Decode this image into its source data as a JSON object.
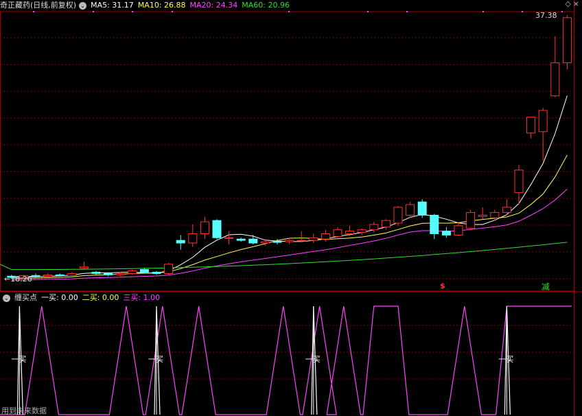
{
  "main_header": {
    "title": "奇正藏药(日线,前复权)",
    "ma": [
      {
        "label": "MA5: 31.17",
        "color": "#ffffff"
      },
      {
        "label": "MA10: 26.88",
        "color": "#ffff55"
      },
      {
        "label": "MA20: 24.34",
        "color": "#ff44ff"
      },
      {
        "label": "MA60: 20.96",
        "color": "#33dd33"
      }
    ]
  },
  "price_labels": {
    "high": "37.38",
    "low": "18.26"
  },
  "markers": {
    "sell": "$",
    "reduce": "减"
  },
  "indicator_header": {
    "name": "缠买点",
    "items": [
      {
        "label": "一买: 0.00",
        "color": "#ffffff"
      },
      {
        "label": "二买: 0.00",
        "color": "#ffff55"
      },
      {
        "label": "三买: 1.00",
        "color": "#ff44ff"
      }
    ]
  },
  "signal_label": "一买",
  "footer_text": "用到未来数据",
  "colors": {
    "up": "#ff3333",
    "down": "#55ffff",
    "grid": "#8b0000",
    "border": "#a00000"
  },
  "chart_data": {
    "type": "candlestick",
    "title": "奇正藏药(日线,前复权)",
    "candles": [
      [
        18.4,
        18.5,
        18.2,
        18.3
      ],
      [
        18.3,
        18.5,
        18.2,
        18.45
      ],
      [
        18.45,
        18.6,
        18.3,
        18.4
      ],
      [
        18.4,
        18.6,
        18.3,
        18.5
      ],
      [
        18.5,
        18.6,
        18.4,
        18.45
      ],
      [
        18.45,
        18.7,
        18.4,
        18.6
      ],
      [
        19.0,
        19.5,
        18.9,
        19.1
      ],
      [
        18.7,
        18.8,
        18.5,
        18.6
      ],
      [
        18.6,
        18.7,
        18.4,
        18.5
      ],
      [
        18.5,
        18.7,
        18.4,
        18.6
      ],
      [
        18.6,
        18.9,
        18.5,
        18.8
      ],
      [
        18.9,
        19.0,
        18.6,
        18.7
      ],
      [
        18.7,
        18.8,
        18.5,
        18.6
      ],
      [
        18.6,
        19.4,
        18.5,
        19.3
      ],
      [
        21.1,
        21.5,
        20.4,
        20.9
      ],
      [
        20.9,
        22.3,
        20.6,
        21.6
      ],
      [
        21.6,
        22.9,
        21.2,
        22.5
      ],
      [
        22.6,
        22.7,
        21.2,
        21.3
      ],
      [
        21.3,
        21.8,
        20.8,
        21.3
      ],
      [
        21.2,
        21.3,
        21.0,
        21.1
      ],
      [
        21.2,
        21.5,
        20.8,
        20.9
      ],
      [
        20.9,
        21.2,
        20.7,
        21.0
      ],
      [
        21.0,
        21.2,
        20.8,
        20.95
      ],
      [
        21.0,
        21.3,
        20.8,
        21.1
      ],
      [
        21.05,
        21.8,
        21.0,
        21.1
      ],
      [
        21.1,
        21.6,
        20.9,
        21.3
      ],
      [
        21.2,
        21.9,
        21.0,
        21.6
      ],
      [
        21.4,
        22.1,
        21.2,
        21.9
      ],
      [
        21.6,
        22.2,
        21.4,
        21.8
      ],
      [
        21.7,
        22.0,
        21.5,
        21.9
      ],
      [
        21.9,
        22.5,
        21.7,
        22.3
      ],
      [
        22.1,
        22.7,
        21.9,
        22.6
      ],
      [
        22.4,
        23.7,
        22.2,
        23.6
      ],
      [
        23.0,
        24.0,
        22.8,
        23.8
      ],
      [
        24.0,
        24.2,
        22.8,
        23.0
      ],
      [
        23.0,
        23.1,
        21.2,
        21.6
      ],
      [
        21.8,
        22.1,
        21.3,
        21.5
      ],
      [
        21.5,
        22.5,
        21.4,
        22.2
      ],
      [
        22.0,
        23.4,
        21.9,
        23.2
      ],
      [
        22.9,
        23.6,
        22.7,
        23.0
      ],
      [
        22.8,
        23.4,
        22.6,
        23.2
      ],
      [
        23.2,
        24.2,
        23.0,
        23.6
      ],
      [
        24.7,
        26.8,
        23.8,
        26.4
      ],
      [
        29.2,
        30.0,
        28.8,
        30.4
      ],
      [
        29.3,
        31.1,
        27.1,
        30.9
      ],
      [
        32.0,
        36.5,
        31.9,
        34.5
      ],
      [
        34.5,
        38.1,
        34.0,
        37.9
      ]
    ],
    "ma_last": {
      "MA5": 31.17,
      "MA10": 26.88,
      "MA20": 24.34,
      "MA60": 20.96
    },
    "price_high": 37.38,
    "price_low": 18.26,
    "indicator": {
      "name": "缠买点",
      "三买_pulses": [
        [
          2,
          3
        ],
        [
          9,
          10
        ],
        [
          12,
          13
        ],
        [
          15,
          16
        ],
        [
          22,
          23
        ],
        [
          25,
          26
        ],
        [
          27,
          28
        ],
        [
          30,
          32
        ],
        [
          37,
          38
        ],
        [
          41,
          47
        ]
      ],
      "一买_pulses": [
        1,
        12,
        25,
        41
      ],
      "last": {
        "一买": 0.0,
        "二买": 0.0,
        "三买": 1.0
      }
    }
  }
}
